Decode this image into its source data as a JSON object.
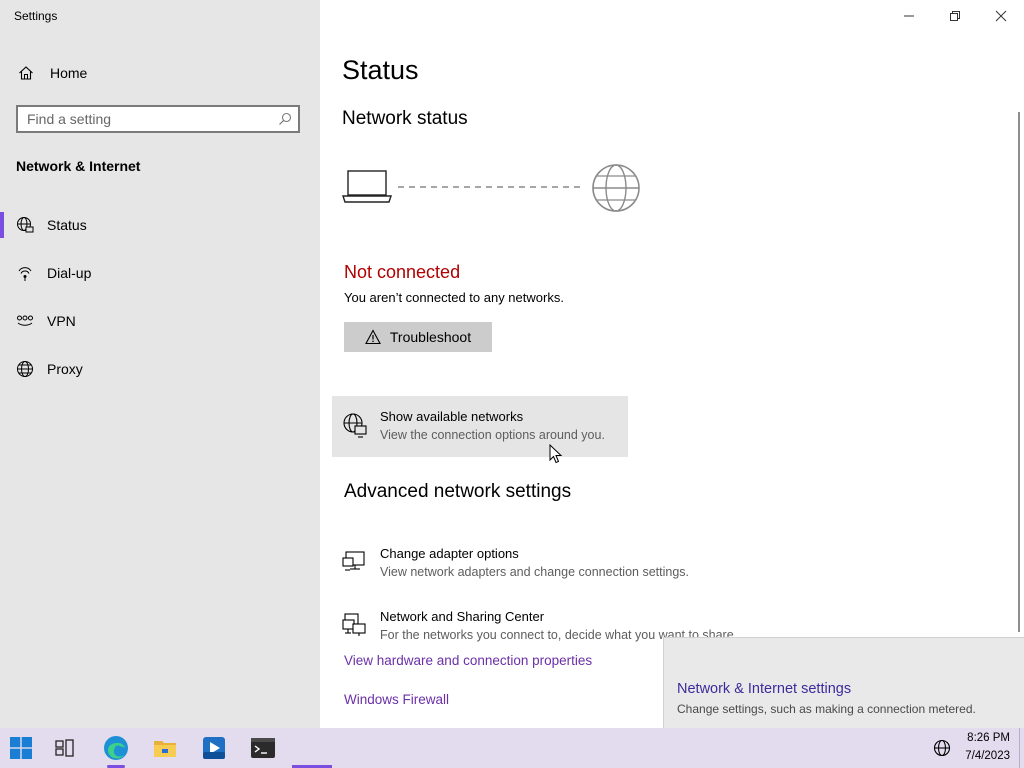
{
  "window": {
    "title": "Settings",
    "controls": {
      "minimize": "minimize",
      "restore": "restore",
      "close": "close"
    }
  },
  "sidebar": {
    "home_label": "Home",
    "search_placeholder": "Find a setting",
    "section_title": "Network & Internet",
    "items": [
      {
        "label": "Status",
        "icon": "globe-network-icon",
        "selected": true
      },
      {
        "label": "Dial-up",
        "icon": "dialup-icon",
        "selected": false
      },
      {
        "label": "VPN",
        "icon": "vpn-icon",
        "selected": false
      },
      {
        "label": "Proxy",
        "icon": "globe-icon",
        "selected": false
      }
    ],
    "accent_color": "#7a4ee0"
  },
  "main": {
    "title": "Status",
    "network_status_heading": "Network status",
    "connection_state": "Not connected",
    "connection_state_color": "#b00000",
    "connection_description": "You aren’t connected to any networks.",
    "troubleshoot_label": "Troubleshoot",
    "show_networks": {
      "title": "Show available networks",
      "description": "View the connection options around you."
    },
    "advanced_heading": "Advanced network settings",
    "adapter_options": {
      "title": "Change adapter options",
      "description": "View network adapters and change connection settings."
    },
    "sharing_center": {
      "title": "Network and Sharing Center",
      "description": "For the networks you connect to, decide what you want to share."
    },
    "link_hardware": "View hardware and connection properties",
    "link_firewall": "Windows Firewall",
    "link_color": "#6b2fa8"
  },
  "flyout": {
    "title": "Network & Internet settings",
    "description": "Change settings, such as making a connection metered."
  },
  "taskbar": {
    "apps": [
      "start-icon",
      "task-view-icon",
      "edge-icon",
      "file-explorer-icon",
      "media-app-icon",
      "terminal-icon"
    ],
    "time": "8:26 PM",
    "date": "7/4/2023"
  }
}
